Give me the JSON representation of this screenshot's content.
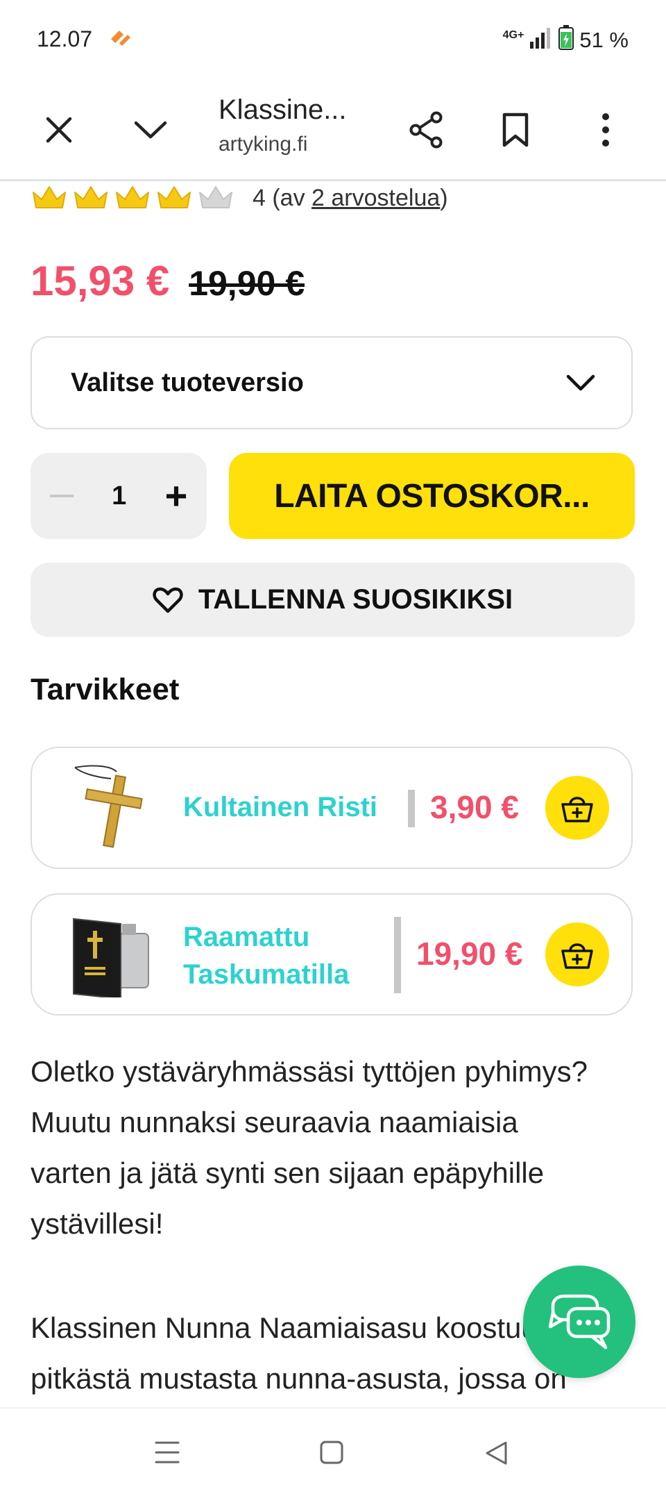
{
  "status_bar": {
    "time": "12.07",
    "network": "4G+",
    "battery": "51 %"
  },
  "toolbar": {
    "title": "Klassine...",
    "url": "artyking.fi"
  },
  "product": {
    "rating_score": 4,
    "rating_max": 5,
    "rating_text_prefix": "4 (av ",
    "rating_link": "2 arvostelua",
    "rating_text_suffix": ")",
    "price_now": "15,93 €",
    "price_old": "19,90 €",
    "variant_placeholder": "Valitse tuoteversio",
    "quantity": "1",
    "add_to_cart": "LAITA OSTOSKOR...",
    "save_favorite": "TALLENNA SUOSIKIKSI"
  },
  "accessories": {
    "title": "Tarvikkeet",
    "items": [
      {
        "name": "Kultainen Risti",
        "price": "3,90 €"
      },
      {
        "name_line1": "Raamattu",
        "name_line2": "Taskumatilla",
        "price": "19,90 €"
      }
    ]
  },
  "description": {
    "p1": "Oletko ystäväryhmässäsi tyttöjen pyhimys? Muutu nunnaksi seuraavia naamiaisia varten ja jätä synti sen sijaan epäpyhille ystävillesi!",
    "p2": "Klassinen Nunna Naamiaisasu koostuu pitkästä mustasta nunna-asusta, jossa on"
  },
  "colors": {
    "accent_yellow": "#ffe00a",
    "price_red": "#f1506b",
    "link_teal": "#2dd2cf",
    "chat_green": "#24c07e"
  },
  "icons": [
    "close-icon",
    "chevron-down-icon",
    "share-icon",
    "bookmark-icon",
    "more-vert-icon",
    "crown-icon",
    "heart-icon",
    "basket-add-icon",
    "chat-icon",
    "nav-menu-icon",
    "nav-home-icon",
    "nav-back-icon"
  ]
}
